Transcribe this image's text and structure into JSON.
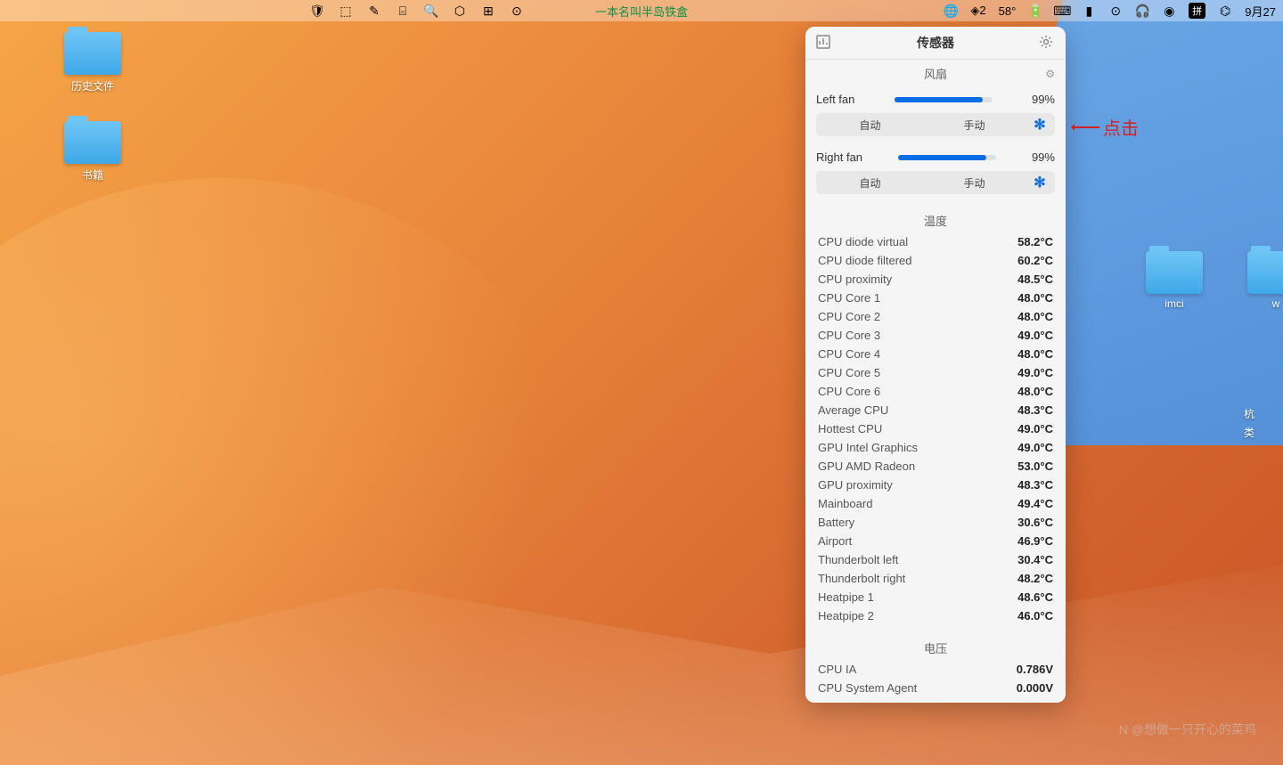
{
  "menubar": {
    "center_text": "一本名叫半岛铁盒",
    "right": {
      "count": "2",
      "temp": "58°",
      "ime": "拼",
      "date": "9月27"
    }
  },
  "desktop": {
    "folder1": "历史文件",
    "folder2": "书籍",
    "folder3": "imci",
    "folder4_partial": "w",
    "right_label1": "杭",
    "right_label2": "类"
  },
  "panel": {
    "title": "传感器",
    "fan_header": "风扇",
    "fans": [
      {
        "name": "Left fan",
        "percent": "99%",
        "fill": 90
      },
      {
        "name": "Right fan",
        "percent": "99%",
        "fill": 90
      }
    ],
    "seg": {
      "auto": "自动",
      "manual": "手动"
    },
    "temp_header": "温度",
    "temps": [
      {
        "name": "CPU diode virtual",
        "val": "58.2°C"
      },
      {
        "name": "CPU diode filtered",
        "val": "60.2°C"
      },
      {
        "name": "CPU proximity",
        "val": "48.5°C"
      },
      {
        "name": "CPU Core 1",
        "val": "48.0°C"
      },
      {
        "name": "CPU Core 2",
        "val": "48.0°C"
      },
      {
        "name": "CPU Core 3",
        "val": "49.0°C"
      },
      {
        "name": "CPU Core 4",
        "val": "48.0°C"
      },
      {
        "name": "CPU Core 5",
        "val": "49.0°C"
      },
      {
        "name": "CPU Core 6",
        "val": "48.0°C"
      },
      {
        "name": "Average CPU",
        "val": "48.3°C"
      },
      {
        "name": "Hottest CPU",
        "val": "49.0°C"
      },
      {
        "name": "GPU Intel Graphics",
        "val": "49.0°C"
      },
      {
        "name": "GPU AMD Radeon",
        "val": "53.0°C"
      },
      {
        "name": "GPU proximity",
        "val": "48.3°C"
      },
      {
        "name": "Mainboard",
        "val": "49.4°C"
      },
      {
        "name": "Battery",
        "val": "30.6°C"
      },
      {
        "name": "Airport",
        "val": "46.9°C"
      },
      {
        "name": "Thunderbolt left",
        "val": "30.4°C"
      },
      {
        "name": "Thunderbolt right",
        "val": "48.2°C"
      },
      {
        "name": "Heatpipe 1",
        "val": "48.6°C"
      },
      {
        "name": "Heatpipe 2",
        "val": "46.0°C"
      }
    ],
    "volt_header": "电压",
    "volts": [
      {
        "name": "CPU IA",
        "val": "0.786V"
      },
      {
        "name": "CPU System Agent",
        "val": "0.000V"
      }
    ]
  },
  "annotation": "点击",
  "watermark": "N @想做一只开心的菜鸡"
}
